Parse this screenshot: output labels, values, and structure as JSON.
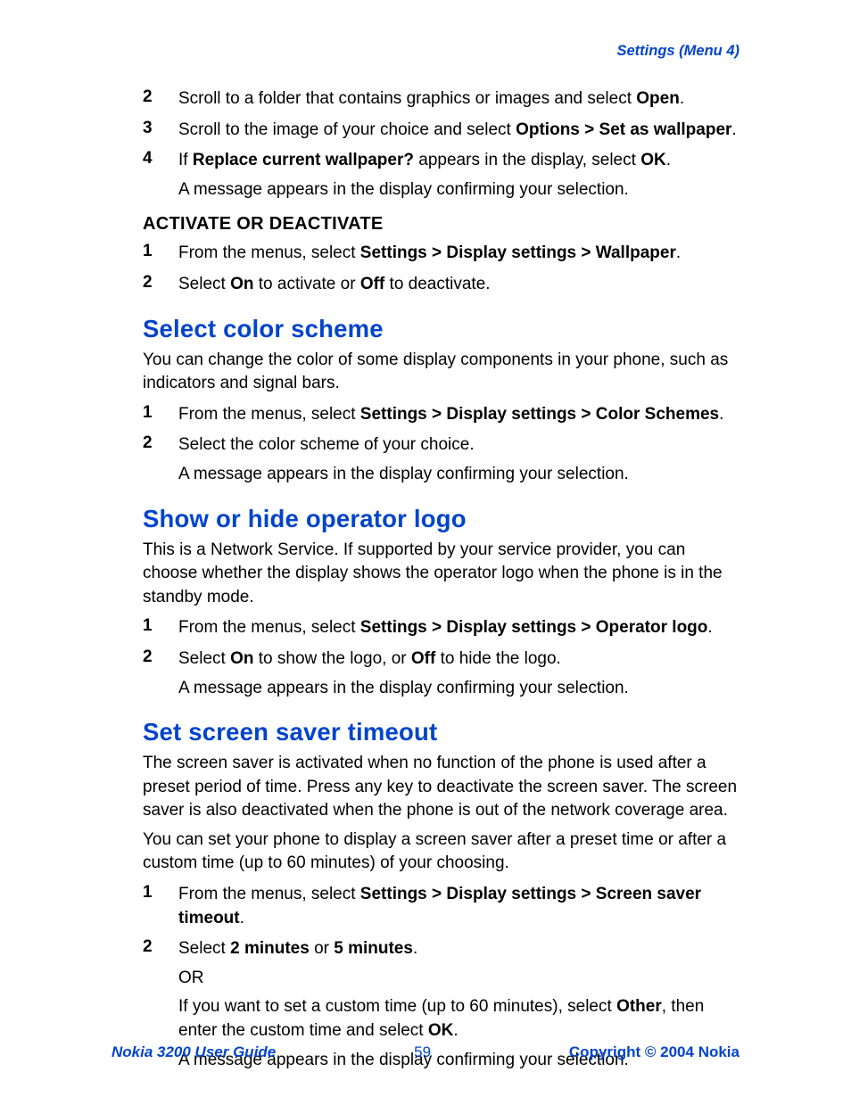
{
  "header": "Settings (Menu 4)",
  "topSteps": [
    {
      "num": "2",
      "parts": [
        "Scroll to a folder that contains graphics or images and select ",
        "Open",
        "."
      ]
    },
    {
      "num": "3",
      "parts": [
        "Scroll to the image of your choice and select ",
        "Options > Set as wallpaper",
        "."
      ]
    },
    {
      "num": "4",
      "parts": [
        "If ",
        "Replace current wallpaper?",
        " appears in the display, select ",
        "OK",
        "."
      ],
      "after": "A message appears in the display confirming your selection."
    }
  ],
  "activate": {
    "title": "ACTIVATE OR DEACTIVATE",
    "steps": [
      {
        "num": "1",
        "parts": [
          "From the menus, select ",
          "Settings > Display settings > Wallpaper",
          "."
        ]
      },
      {
        "num": "2",
        "parts": [
          "Select ",
          "On",
          " to activate or ",
          "Off",
          " to deactivate."
        ]
      }
    ]
  },
  "colorScheme": {
    "title": "Select color scheme",
    "intro": "You can change the color of some display components in your phone, such as indicators and signal bars.",
    "steps": [
      {
        "num": "1",
        "parts": [
          "From the menus, select ",
          "Settings > Display settings > Color Schemes",
          "."
        ]
      },
      {
        "num": "2",
        "parts": [
          "Select the color scheme of your choice."
        ],
        "after": "A message appears in the display confirming your selection."
      }
    ]
  },
  "operatorLogo": {
    "title": "Show or hide operator logo",
    "intro": "This is a Network Service. If supported by your service provider, you can choose whether the display shows the operator logo when the phone is in the standby mode.",
    "steps": [
      {
        "num": "1",
        "parts": [
          "From the menus, select ",
          "Settings > Display settings > Operator logo",
          "."
        ]
      },
      {
        "num": "2",
        "parts": [
          "Select ",
          "On",
          " to show the logo, or ",
          "Off",
          " to hide the logo."
        ],
        "after": "A message appears in the display confirming your selection."
      }
    ]
  },
  "screenSaver": {
    "title": "Set screen saver timeout",
    "intro1": "The screen saver is activated when no function of the phone is used after a preset period of time. Press any key to deactivate the screen saver. The screen saver is also deactivated when the phone is out of the network coverage area.",
    "intro2": "You can set your phone to display a screen saver after a preset time or after a custom time (up to 60 minutes) of your choosing.",
    "steps": [
      {
        "num": "1",
        "parts": [
          "From the menus, select ",
          "Settings > Display settings > Screen saver timeout",
          "."
        ]
      },
      {
        "num": "2",
        "parts": [
          "Select ",
          "2 minutes",
          " or ",
          "5 minutes",
          "."
        ],
        "after": "OR",
        "after2parts": [
          "If you want to set a custom time (up to 60 minutes), select ",
          "Other",
          ", then enter the custom time and select ",
          "OK",
          "."
        ],
        "after3": "A message appears in the display confirming your selection."
      }
    ]
  },
  "footer": {
    "left": "Nokia 3200 User Guide",
    "center": "59",
    "right": "Copyright © 2004 Nokia"
  }
}
